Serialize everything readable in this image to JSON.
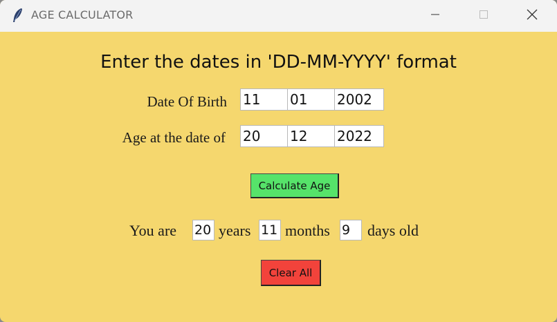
{
  "window": {
    "title": "AGE CALCULATOR",
    "icon": "feather-icon",
    "controls": [
      "minimize-icon",
      "maximize-icon",
      "close-icon"
    ]
  },
  "main": {
    "heading": "Enter the dates in 'DD-MM-YYYY' format",
    "dob": {
      "label": "Date Of Birth",
      "day": "11",
      "month": "01",
      "year": "2002"
    },
    "target": {
      "label": "Age at the date of",
      "day": "20",
      "month": "12",
      "year": "2022"
    },
    "calculate_label": "Calculate Age",
    "result": {
      "prefix": "You are",
      "years_value": "20",
      "years_label": "years",
      "months_value": "11",
      "months_label": "months",
      "days_value": "9",
      "days_label": "days old"
    },
    "clear_label": "Clear All"
  },
  "colors": {
    "background": "#f5d76e",
    "calculate_button": "#56e36a",
    "clear_button": "#f2433b",
    "titlebar": "#f3f3f3"
  }
}
